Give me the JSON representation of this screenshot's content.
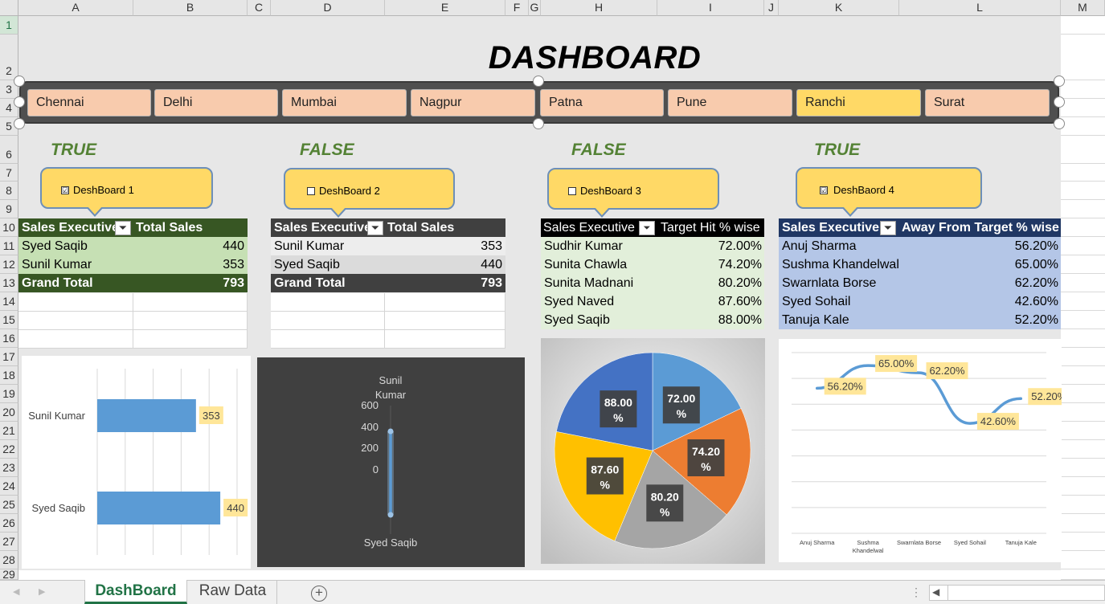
{
  "columns": [
    "A",
    "B",
    "C",
    "D",
    "E",
    "F",
    "G",
    "H",
    "I",
    "J",
    "K",
    "L",
    "M"
  ],
  "rows": [
    "1",
    "2",
    "3",
    "4",
    "5",
    "6",
    "7",
    "8",
    "9",
    "10",
    "11",
    "12",
    "13",
    "14",
    "15",
    "16",
    "17",
    "18",
    "19",
    "20",
    "21",
    "22",
    "23",
    "24",
    "25",
    "26",
    "27",
    "28",
    "29"
  ],
  "title": "DASHBOARD",
  "slicer": {
    "items": [
      "Chennai",
      "Delhi",
      "Mumbai",
      "Nagpur",
      "Patna",
      "Pune",
      "Ranchi",
      "Surat"
    ],
    "selected": "Ranchi"
  },
  "checks": [
    {
      "value": "TRUE",
      "label": "DeshBoard 1",
      "checked": true,
      "mark": "☑"
    },
    {
      "value": "FALSE",
      "label": "DeshBoard 2",
      "checked": false,
      "mark": ""
    },
    {
      "value": "FALSE",
      "label": "DeshBoard 3",
      "checked": false,
      "mark": ""
    },
    {
      "value": "TRUE",
      "label": "DeshBaord 4",
      "checked": true,
      "mark": "☑"
    }
  ],
  "pivot1": {
    "headers": [
      "Sales Executive",
      "Total Sales"
    ],
    "rows": [
      [
        "Syed Saqib",
        "440"
      ],
      [
        "Sunil Kumar",
        "353"
      ]
    ],
    "total": [
      "Grand Total",
      "793"
    ]
  },
  "pivot2": {
    "headers": [
      "Sales Executive",
      "Total Sales"
    ],
    "rows": [
      [
        "Sunil Kumar",
        "353"
      ],
      [
        "Syed Saqib",
        "440"
      ]
    ],
    "total": [
      "Grand Total",
      "793"
    ]
  },
  "pivot3": {
    "headers": [
      "Sales Executive",
      "Target Hit % wise"
    ],
    "rows": [
      [
        "Sudhir Kumar",
        "72.00%"
      ],
      [
        "Sunita Chawla",
        "74.20%"
      ],
      [
        "Sunita Madnani",
        "80.20%"
      ],
      [
        "Syed Naved",
        "87.60%"
      ],
      [
        "Syed Saqib",
        "88.00%"
      ]
    ]
  },
  "pivot4": {
    "headers": [
      "Sales Executive",
      "Away From Target % wise"
    ],
    "rows": [
      [
        "Anuj Sharma",
        "56.20%"
      ],
      [
        "Sushma Khandelwal",
        "65.00%"
      ],
      [
        "Swarnlata Borse",
        "62.20%"
      ],
      [
        "Syed Sohail",
        "42.60%"
      ],
      [
        "Tanuja Kale",
        "52.20%"
      ]
    ]
  },
  "chart_data": [
    {
      "type": "bar",
      "categories": [
        "Sunil Kumar",
        "Syed Saqib"
      ],
      "values": [
        353,
        440
      ],
      "value_labels": [
        "353",
        "440"
      ],
      "title": "",
      "xlabel": "",
      "ylabel": "",
      "grid": true
    },
    {
      "type": "line",
      "categories": [
        "Sunil Kumar",
        "Syed Saqib"
      ],
      "values": [
        353,
        440
      ],
      "y_ticks": [
        "600",
        "400",
        "200",
        "0"
      ],
      "top_label": [
        "Sunil",
        "Kumar"
      ],
      "bottom_label": "Syed Saqib",
      "title": "",
      "xlabel": "",
      "ylabel": ""
    },
    {
      "type": "pie",
      "categories": [
        "Sudhir Kumar",
        "Sunita Chawla",
        "Sunita Madnani",
        "Syed Naved",
        "Syed Saqib"
      ],
      "values": [
        72.0,
        74.2,
        80.2,
        87.6,
        88.0
      ],
      "labels": [
        [
          "72.00",
          "%"
        ],
        [
          "74.20",
          "%"
        ],
        [
          "80.20",
          "%"
        ],
        [
          "87.60",
          "%"
        ],
        [
          "88.00",
          "%"
        ]
      ],
      "colors": [
        "#5b9bd5",
        "#ed7d31",
        "#a5a5a5",
        "#ffc000",
        "#4472c4"
      ],
      "title": ""
    },
    {
      "type": "line",
      "categories": [
        "Anuj Sharma",
        "Sushma Khandelwal",
        "Swarnlata Borse",
        "Syed Sohail",
        "Tanuja Kale"
      ],
      "category_labels": [
        [
          "Anuj Sharma"
        ],
        [
          "Sushma",
          "Khandelwal"
        ],
        [
          "Swarnlata Borse"
        ],
        [
          "Syed Sohail"
        ],
        [
          "Tanuja Kale"
        ]
      ],
      "values": [
        56.2,
        65.0,
        62.2,
        42.6,
        52.2
      ],
      "value_labels": [
        "56.20%",
        "65.00%",
        "62.20%",
        "42.60%",
        "52.20%"
      ],
      "title": "",
      "xlabel": "",
      "ylabel": "",
      "grid": true
    }
  ],
  "tabs": [
    "DashBoard",
    "Raw Data"
  ],
  "active_tab": "DashBoard",
  "add_sheet": "+",
  "colors": {
    "accent": "#217346",
    "pivot1_header": "#375623",
    "pivot1_row": "#c6e0b4",
    "pivot2_header": "#404040",
    "pivot3_row": "#e2efda",
    "pivot4_header": "#203764",
    "pivot4_row": "#b4c6e7"
  }
}
